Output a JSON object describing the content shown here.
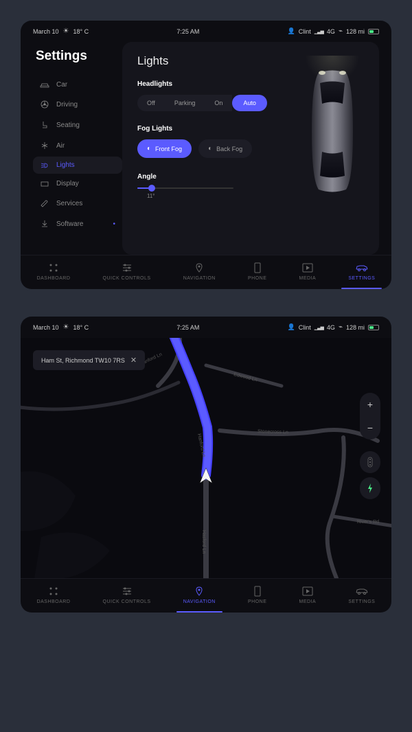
{
  "status": {
    "date": "March 10",
    "temp": "18° C",
    "time": "7:25 AM",
    "user": "Clint",
    "network": "4G",
    "range": "128 mi"
  },
  "settings": {
    "title": "Settings",
    "items": [
      {
        "label": "Car",
        "icon": "car"
      },
      {
        "label": "Driving",
        "icon": "wheel"
      },
      {
        "label": "Seating",
        "icon": "seat"
      },
      {
        "label": "Air",
        "icon": "air"
      },
      {
        "label": "Lights",
        "icon": "lights"
      },
      {
        "label": "Display",
        "icon": "display"
      },
      {
        "label": "Services",
        "icon": "wrench"
      },
      {
        "label": "Software",
        "icon": "download"
      }
    ],
    "panel": {
      "title": "Lights",
      "headlights": {
        "label": "Headlights",
        "options": [
          "Off",
          "Parking",
          "On",
          "Auto"
        ],
        "selected": "Auto"
      },
      "fog": {
        "label": "Fog Lights",
        "front": "Front Fog",
        "back": "Back Fog",
        "selected": "front"
      },
      "angle": {
        "label": "Angle",
        "value": "11°"
      }
    }
  },
  "nav_items": [
    {
      "label": "DASHBOARD",
      "icon": "grid"
    },
    {
      "label": "QUICK CONTROLS",
      "icon": "sliders"
    },
    {
      "label": "NAVIGATION",
      "icon": "pin"
    },
    {
      "label": "PHONE",
      "icon": "phone"
    },
    {
      "label": "MEDIA",
      "icon": "play"
    },
    {
      "label": "SETTINGS",
      "icon": "car-side"
    }
  ],
  "screen1_active_nav": "SETTINGS",
  "screen2_active_nav": "NAVIGATION",
  "map": {
    "search": "Ham St, Richmond TW10 7RS",
    "roads": {
      "r1": "Hanford Ln",
      "r2": "Edwood Ln",
      "r3": "Stonecross Ln",
      "r4": "River's Rd",
      "r5": "Hasford Ln"
    }
  }
}
